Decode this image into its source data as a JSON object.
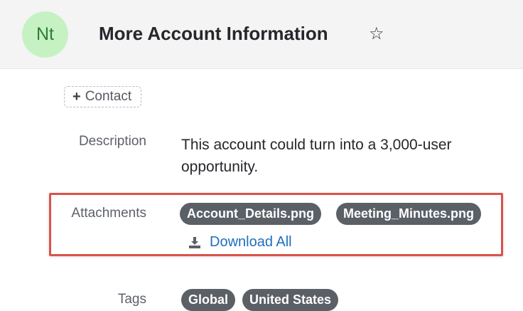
{
  "header": {
    "avatar_initials": "Nt",
    "title": "More Account Information",
    "star_icon": "star-outline-icon"
  },
  "contact_button": {
    "label": "Contact",
    "icon": "plus-icon"
  },
  "fields": {
    "description": {
      "label": "Description",
      "value": "This account could turn into a 3,000-user opportunity."
    },
    "attachments": {
      "label": "Attachments",
      "files": [
        "Account_Details.png",
        "Meeting_Minutes.png"
      ],
      "download_all_label": "Download All",
      "download_icon": "download-icon"
    },
    "tags": {
      "label": "Tags",
      "items": [
        "Global",
        "United States"
      ]
    }
  },
  "colors": {
    "avatar_bg": "#c6f2c3",
    "avatar_text": "#2d7d35",
    "highlight_border": "#d9534a",
    "pill_bg": "#5b5f66",
    "link": "#1f6fbe"
  }
}
